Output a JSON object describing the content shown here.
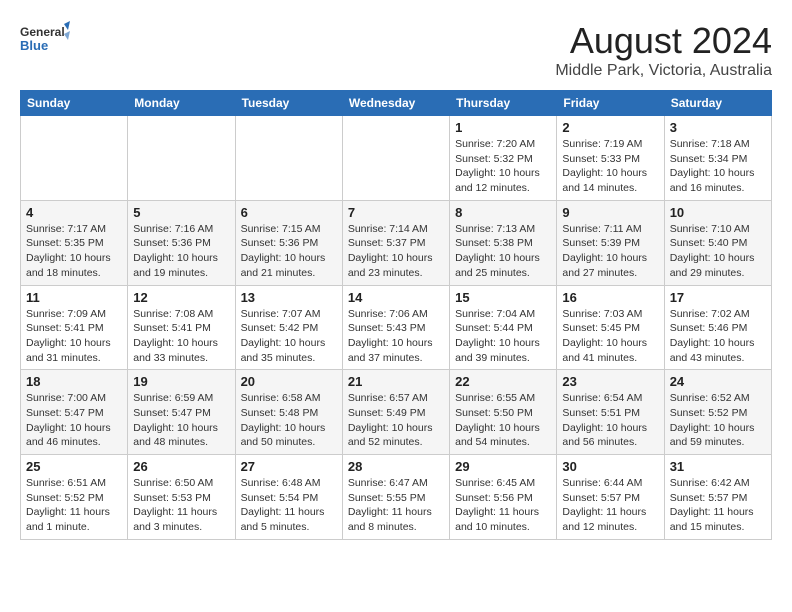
{
  "header": {
    "logo_line1": "General",
    "logo_line2": "Blue",
    "main_title": "August 2024",
    "subtitle": "Middle Park, Victoria, Australia"
  },
  "calendar": {
    "days_of_week": [
      "Sunday",
      "Monday",
      "Tuesday",
      "Wednesday",
      "Thursday",
      "Friday",
      "Saturday"
    ],
    "weeks": [
      [
        {
          "day": "",
          "info": ""
        },
        {
          "day": "",
          "info": ""
        },
        {
          "day": "",
          "info": ""
        },
        {
          "day": "",
          "info": ""
        },
        {
          "day": "1",
          "info": "Sunrise: 7:20 AM\nSunset: 5:32 PM\nDaylight: 10 hours\nand 12 minutes."
        },
        {
          "day": "2",
          "info": "Sunrise: 7:19 AM\nSunset: 5:33 PM\nDaylight: 10 hours\nand 14 minutes."
        },
        {
          "day": "3",
          "info": "Sunrise: 7:18 AM\nSunset: 5:34 PM\nDaylight: 10 hours\nand 16 minutes."
        }
      ],
      [
        {
          "day": "4",
          "info": "Sunrise: 7:17 AM\nSunset: 5:35 PM\nDaylight: 10 hours\nand 18 minutes."
        },
        {
          "day": "5",
          "info": "Sunrise: 7:16 AM\nSunset: 5:36 PM\nDaylight: 10 hours\nand 19 minutes."
        },
        {
          "day": "6",
          "info": "Sunrise: 7:15 AM\nSunset: 5:36 PM\nDaylight: 10 hours\nand 21 minutes."
        },
        {
          "day": "7",
          "info": "Sunrise: 7:14 AM\nSunset: 5:37 PM\nDaylight: 10 hours\nand 23 minutes."
        },
        {
          "day": "8",
          "info": "Sunrise: 7:13 AM\nSunset: 5:38 PM\nDaylight: 10 hours\nand 25 minutes."
        },
        {
          "day": "9",
          "info": "Sunrise: 7:11 AM\nSunset: 5:39 PM\nDaylight: 10 hours\nand 27 minutes."
        },
        {
          "day": "10",
          "info": "Sunrise: 7:10 AM\nSunset: 5:40 PM\nDaylight: 10 hours\nand 29 minutes."
        }
      ],
      [
        {
          "day": "11",
          "info": "Sunrise: 7:09 AM\nSunset: 5:41 PM\nDaylight: 10 hours\nand 31 minutes."
        },
        {
          "day": "12",
          "info": "Sunrise: 7:08 AM\nSunset: 5:41 PM\nDaylight: 10 hours\nand 33 minutes."
        },
        {
          "day": "13",
          "info": "Sunrise: 7:07 AM\nSunset: 5:42 PM\nDaylight: 10 hours\nand 35 minutes."
        },
        {
          "day": "14",
          "info": "Sunrise: 7:06 AM\nSunset: 5:43 PM\nDaylight: 10 hours\nand 37 minutes."
        },
        {
          "day": "15",
          "info": "Sunrise: 7:04 AM\nSunset: 5:44 PM\nDaylight: 10 hours\nand 39 minutes."
        },
        {
          "day": "16",
          "info": "Sunrise: 7:03 AM\nSunset: 5:45 PM\nDaylight: 10 hours\nand 41 minutes."
        },
        {
          "day": "17",
          "info": "Sunrise: 7:02 AM\nSunset: 5:46 PM\nDaylight: 10 hours\nand 43 minutes."
        }
      ],
      [
        {
          "day": "18",
          "info": "Sunrise: 7:00 AM\nSunset: 5:47 PM\nDaylight: 10 hours\nand 46 minutes."
        },
        {
          "day": "19",
          "info": "Sunrise: 6:59 AM\nSunset: 5:47 PM\nDaylight: 10 hours\nand 48 minutes."
        },
        {
          "day": "20",
          "info": "Sunrise: 6:58 AM\nSunset: 5:48 PM\nDaylight: 10 hours\nand 50 minutes."
        },
        {
          "day": "21",
          "info": "Sunrise: 6:57 AM\nSunset: 5:49 PM\nDaylight: 10 hours\nand 52 minutes."
        },
        {
          "day": "22",
          "info": "Sunrise: 6:55 AM\nSunset: 5:50 PM\nDaylight: 10 hours\nand 54 minutes."
        },
        {
          "day": "23",
          "info": "Sunrise: 6:54 AM\nSunset: 5:51 PM\nDaylight: 10 hours\nand 56 minutes."
        },
        {
          "day": "24",
          "info": "Sunrise: 6:52 AM\nSunset: 5:52 PM\nDaylight: 10 hours\nand 59 minutes."
        }
      ],
      [
        {
          "day": "25",
          "info": "Sunrise: 6:51 AM\nSunset: 5:52 PM\nDaylight: 11 hours\nand 1 minute."
        },
        {
          "day": "26",
          "info": "Sunrise: 6:50 AM\nSunset: 5:53 PM\nDaylight: 11 hours\nand 3 minutes."
        },
        {
          "day": "27",
          "info": "Sunrise: 6:48 AM\nSunset: 5:54 PM\nDaylight: 11 hours\nand 5 minutes."
        },
        {
          "day": "28",
          "info": "Sunrise: 6:47 AM\nSunset: 5:55 PM\nDaylight: 11 hours\nand 8 minutes."
        },
        {
          "day": "29",
          "info": "Sunrise: 6:45 AM\nSunset: 5:56 PM\nDaylight: 11 hours\nand 10 minutes."
        },
        {
          "day": "30",
          "info": "Sunrise: 6:44 AM\nSunset: 5:57 PM\nDaylight: 11 hours\nand 12 minutes."
        },
        {
          "day": "31",
          "info": "Sunrise: 6:42 AM\nSunset: 5:57 PM\nDaylight: 11 hours\nand 15 minutes."
        }
      ]
    ]
  }
}
